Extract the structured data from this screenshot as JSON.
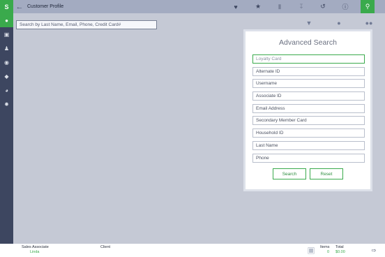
{
  "header": {
    "title": "Customer Profile",
    "icons": [
      "heart-icon",
      "star-icon",
      "barcode-icon",
      "download-icon",
      "undo-icon",
      "info-icon",
      "search-icon"
    ]
  },
  "sidebar": {
    "logo_text": "S",
    "items": [
      "user-icon",
      "cart-icon",
      "group-icon",
      "eye-icon",
      "tag-icon",
      "globe-icon",
      "settings-icon"
    ]
  },
  "search": {
    "placeholder": "Search by Last Name, Email, Phone, Credit Card#"
  },
  "toolbar": {
    "icons": [
      "filter-icon",
      "user-icon",
      "users-icon"
    ]
  },
  "advanced": {
    "title": "Advanced Search",
    "fields": [
      "Loyalty Card",
      "Alternate ID",
      "Username",
      "Associate ID",
      "Email Address",
      "Secondary Member Card",
      "Household ID",
      "Last Name",
      "Phone"
    ],
    "search_label": "Search",
    "reset_label": "Reset"
  },
  "footer": {
    "sales_associate_label": "Sales Associate",
    "sales_associate_value": "Linda",
    "client_label": "Client",
    "items_label": "Items",
    "items_value": "0",
    "total_label": "Total",
    "total_value": "$0.00"
  },
  "colors": {
    "accent": "#3aaa4c",
    "sidebar": "#3d4660",
    "topbar": "#a3abc1",
    "background": "#c5c9d5"
  }
}
